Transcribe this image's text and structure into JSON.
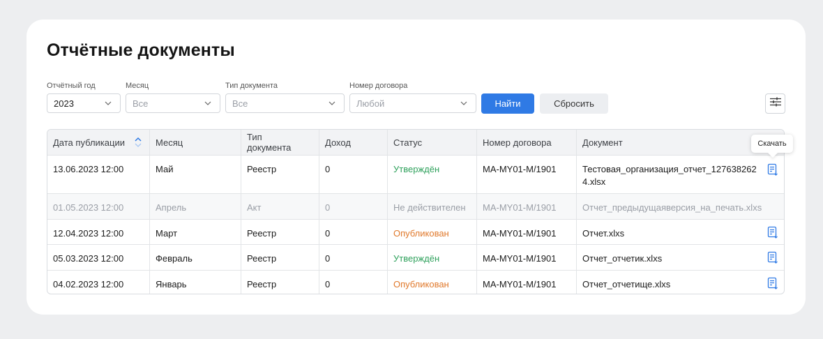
{
  "page": {
    "title": "Отчётные документы"
  },
  "filters": {
    "year": {
      "label": "Отчётный год",
      "value": "2023"
    },
    "month": {
      "label": "Месяц",
      "placeholder": "Все"
    },
    "doc_type": {
      "label": "Тип документа",
      "placeholder": "Все"
    },
    "contract": {
      "label": "Номер договора",
      "placeholder": "Любой"
    },
    "find_label": "Найти",
    "reset_label": "Сбросить"
  },
  "table": {
    "columns": [
      "Дата публикации",
      "Месяц",
      "Тип документа",
      "Доход",
      "Статус",
      "Номер договора",
      "Документ"
    ],
    "rows": [
      {
        "date": "13.06.2023 12:00",
        "month": "Май",
        "type": "Реестр",
        "income": "0",
        "status": "Утверждён",
        "contract": "MA-MY01-M/1901",
        "document": "Тестовая_организация_отчет_1276382624.xlsx"
      },
      {
        "date": "01.05.2023 12:00",
        "month": "Апрель",
        "type": "Акт",
        "income": "0",
        "status": "Не действителен",
        "contract": "MA-MY01-M/1901",
        "document": "Отчет_предыдущаяверсия_на_печать.xlxs"
      },
      {
        "date": "12.04.2023 12:00",
        "month": "Март",
        "type": "Реестр",
        "income": "0",
        "status": "Опубликован",
        "contract": "MA-MY01-M/1901",
        "document": "Отчет.xlxs"
      },
      {
        "date": "05.03.2023 12:00",
        "month": "Февраль",
        "type": "Реестр",
        "income": "0",
        "status": "Утверждён",
        "contract": "MA-MY01-M/1901",
        "document": "Отчет_отчетик.xlxs"
      },
      {
        "date": "04.02.2023 12:00",
        "month": "Январь",
        "type": "Реестр",
        "income": "0",
        "status": "Опубликован",
        "contract": "MA-MY01-M/1901",
        "document": "Отчет_отчетище.xlxs"
      }
    ]
  },
  "tooltip": {
    "text": "Скачать"
  },
  "colors": {
    "accent": "#2f7ae5",
    "approved": "#2fa15c",
    "published": "#e0782a",
    "muted": "#9a9ea6"
  }
}
